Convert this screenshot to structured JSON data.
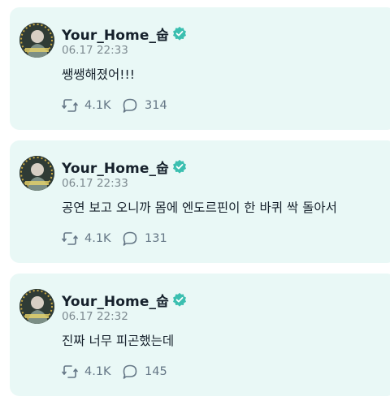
{
  "colors": {
    "card_bg": "#e9f8f6",
    "name": "#15202b",
    "meta": "#7d8a90",
    "action": "#657786",
    "verified": "#3bbfb0"
  },
  "icons": {
    "retweet": "retweet-icon",
    "reply": "reply-bubble-icon",
    "verified": "verified-badge-icon"
  },
  "posts": [
    {
      "author": "Your_Home_숩",
      "time": "06.17 22:33",
      "text": "쌩쌩해졌어!!!",
      "retweets": "4.1K",
      "replies": "314"
    },
    {
      "author": "Your_Home_숩",
      "time": "06.17 22:33",
      "text": "공연 보고 오니까 몸에 엔도르핀이 한 바퀴 싹 돌아서",
      "retweets": "4.1K",
      "replies": "131"
    },
    {
      "author": "Your_Home_숩",
      "time": "06.17 22:32",
      "text": "진짜 너무 피곤했는데",
      "retweets": "4.1K",
      "replies": "145"
    }
  ]
}
